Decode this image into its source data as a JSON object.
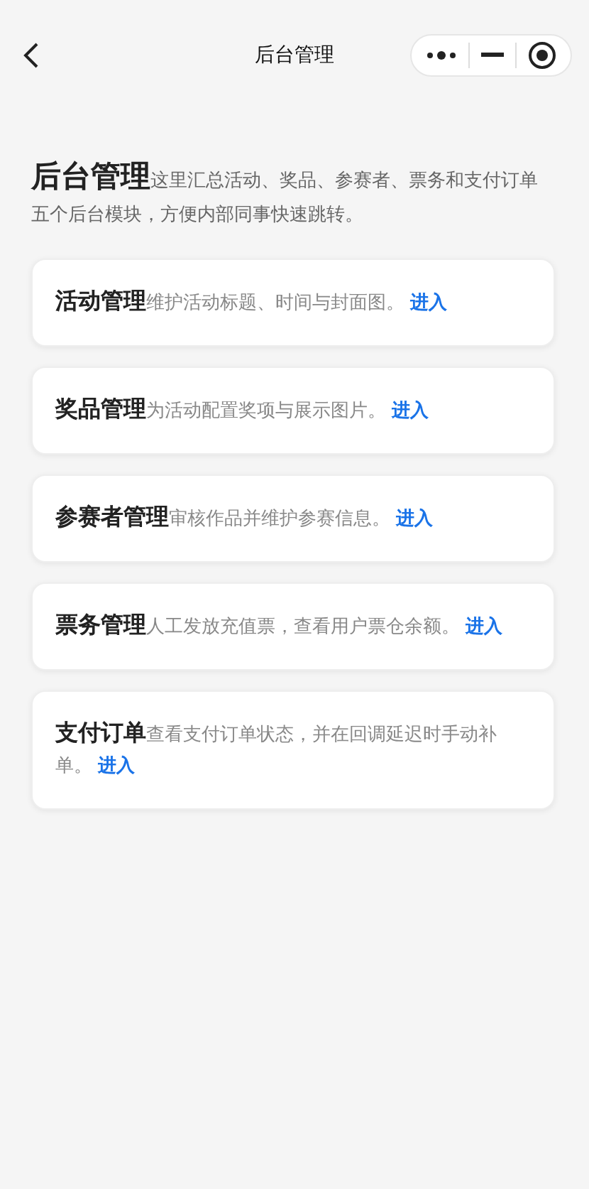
{
  "nav_bar": {
    "title": "后台管理"
  },
  "intro": {
    "title": "后台管理",
    "description": "这里汇总活动、奖品、参赛者、票务和支付订单五个后台模块，方便内部同事快速跳转。"
  },
  "modules": [
    {
      "title": "活动管理",
      "description": "维护活动标题、时间与封面图。",
      "link": "进入"
    },
    {
      "title": "奖品管理",
      "description": "为活动配置奖项与展示图片。",
      "link": "进入"
    },
    {
      "title": "参赛者管理",
      "description": "审核作品并维护参赛信息。",
      "link": "进入"
    },
    {
      "title": "票务管理",
      "description": "人工发放充值票，查看用户票仓余额。",
      "link": "进入"
    },
    {
      "title": "支付订单",
      "description": "查看支付订单状态，并在回调延迟时手动补单。",
      "link": "进入"
    }
  ]
}
